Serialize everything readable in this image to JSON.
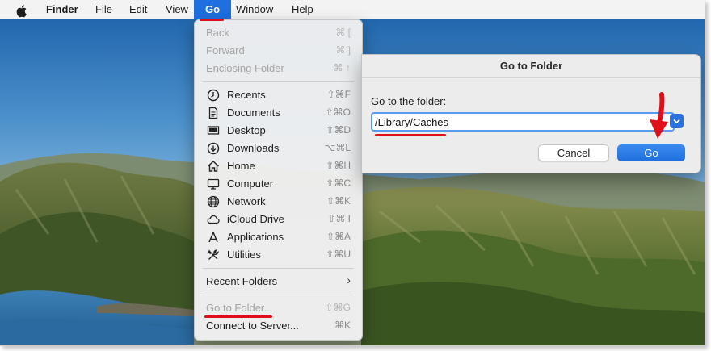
{
  "menubar": {
    "apple_icon": "apple-logo-icon",
    "items": [
      "Finder",
      "File",
      "Edit",
      "View",
      "Go",
      "Window",
      "Help"
    ],
    "active": "Go"
  },
  "go_menu": {
    "group1": [
      {
        "label": "Back",
        "shortcut": "⌘ [",
        "enabled": false
      },
      {
        "label": "Forward",
        "shortcut": "⌘ ]",
        "enabled": false
      },
      {
        "label": "Enclosing Folder",
        "shortcut": "⌘ ↑",
        "enabled": false
      }
    ],
    "group2": [
      {
        "label": "Recents",
        "shortcut": "⇧⌘F",
        "icon": "clock-icon"
      },
      {
        "label": "Documents",
        "shortcut": "⇧⌘O",
        "icon": "document-icon"
      },
      {
        "label": "Desktop",
        "shortcut": "⇧⌘D",
        "icon": "desktop-icon"
      },
      {
        "label": "Downloads",
        "shortcut": "⌥⌘L",
        "icon": "download-icon"
      },
      {
        "label": "Home",
        "shortcut": "⇧⌘H",
        "icon": "home-icon"
      },
      {
        "label": "Computer",
        "shortcut": "⇧⌘C",
        "icon": "computer-icon"
      },
      {
        "label": "Network",
        "shortcut": "⇧⌘K",
        "icon": "globe-icon"
      },
      {
        "label": "iCloud Drive",
        "shortcut": "⇧⌘ I",
        "icon": "cloud-icon"
      },
      {
        "label": "Applications",
        "shortcut": "⇧⌘A",
        "icon": "applications-icon"
      },
      {
        "label": "Utilities",
        "shortcut": "⇧⌘U",
        "icon": "utilities-icon"
      }
    ],
    "recent_folders": {
      "label": "Recent Folders",
      "submenu_icon": "chevron-right-icon"
    },
    "group4": [
      {
        "label": "Go to Folder...",
        "shortcut": "⇧⌘G",
        "enabled": false
      },
      {
        "label": "Connect to Server...",
        "shortcut": "⌘K",
        "enabled": true
      }
    ]
  },
  "dialog": {
    "title": "Go to Folder",
    "prompt": "Go to the folder:",
    "input_value": "/Library/Caches",
    "dropdown_icon": "chevron-down-icon",
    "cancel_label": "Cancel",
    "go_label": "Go"
  },
  "colors": {
    "accent": "#1f6fe0",
    "annotation": "#e0101a"
  }
}
